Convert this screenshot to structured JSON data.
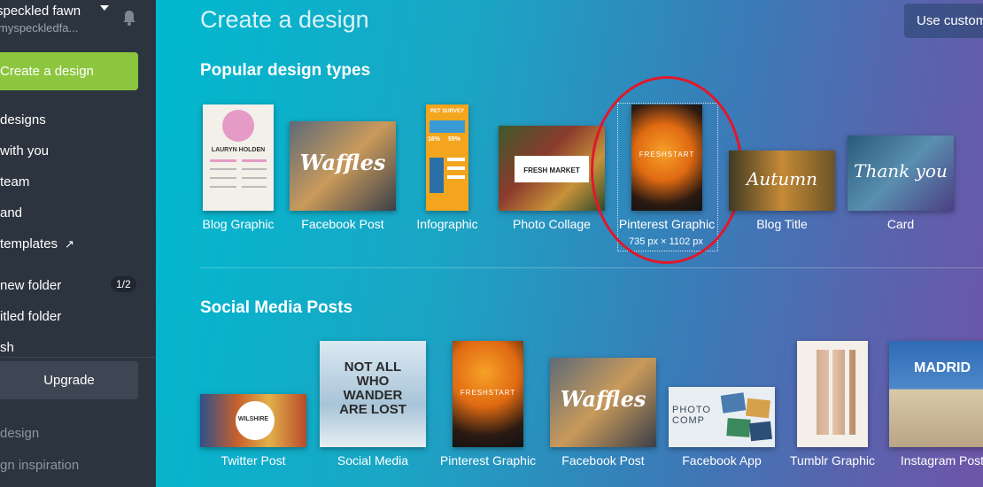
{
  "sidebar": {
    "user_name": "speckled fawn",
    "user_handle": "myspeckledfa...",
    "create_button": "Create a design",
    "nav": [
      {
        "label": "designs"
      },
      {
        "label": "with you"
      },
      {
        "label": "team"
      },
      {
        "label": "and"
      },
      {
        "label": "templates"
      }
    ],
    "folders": [
      {
        "label": "new folder"
      },
      {
        "label": "itled folder"
      },
      {
        "label": "sh"
      }
    ],
    "folder_count": "1/2",
    "upgrade_button": "Upgrade",
    "footer": [
      {
        "label": "design"
      },
      {
        "label": "gn inspiration"
      }
    ]
  },
  "main": {
    "title": "Create a design",
    "custom_button": "Use custom",
    "popular_title": "Popular design types",
    "social_title": "Social Media Posts",
    "popular": [
      {
        "label": "Blog Graphic"
      },
      {
        "label": "Facebook Post"
      },
      {
        "label": "Infographic"
      },
      {
        "label": "Photo Collage"
      },
      {
        "label": "Pinterest Graphic",
        "dimensions": "735 px × 1102 px"
      },
      {
        "label": "Blog Title"
      },
      {
        "label": "Card"
      }
    ],
    "social": [
      {
        "label": "Twitter Post"
      },
      {
        "label": "Social Media"
      },
      {
        "label": "Pinterest Graphic"
      },
      {
        "label": "Facebook Post"
      },
      {
        "label": "Facebook App"
      },
      {
        "label": "Tumblr Graphic"
      },
      {
        "label": "Instagram Post"
      }
    ],
    "thumb_text": {
      "resume_name": "LAURYN HOLDEN",
      "waffles": "Waffles",
      "pet_survey": "PET SURVEY",
      "pct1": "16%",
      "pct2": "55%",
      "fresh_market": "FRESH MARKET",
      "freshstart": "FRESHSTART",
      "autumn": "Autumn",
      "thank_you": "Thank you",
      "wilshire": "WILSHIRE",
      "not_all": "NOT ALL WHO WANDER ARE LOST",
      "photo_comp": "PHOTO COMP",
      "madrid": "MADRID"
    }
  },
  "colors": {
    "accent_green": "#8cc63f",
    "highlight_red": "#e0182b"
  }
}
